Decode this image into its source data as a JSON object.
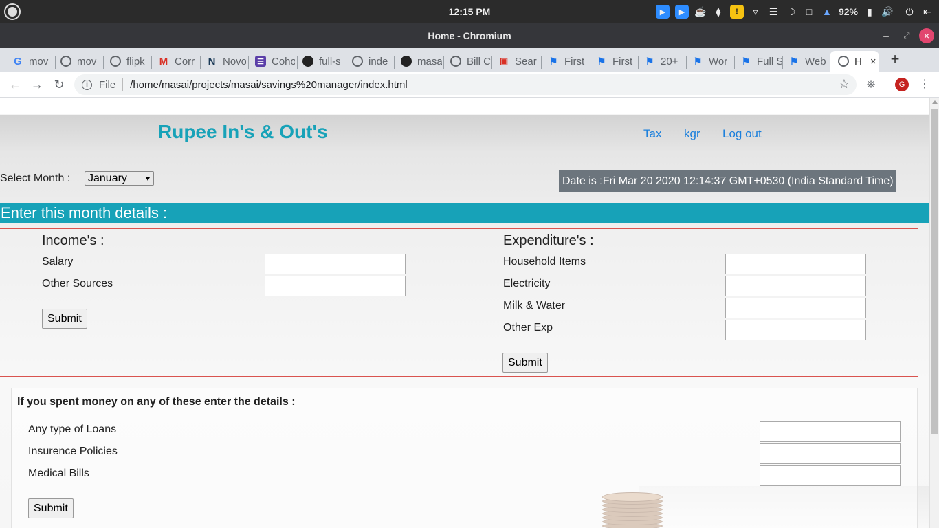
{
  "os": {
    "clock": "12:15 PM",
    "battery_percent": "92%",
    "tray_icons": [
      "zoom-icon",
      "zoom-icon",
      "coffee-icon",
      "slack-icon",
      "warning-icon",
      "wifi-icon",
      "menu-icon",
      "night-mode-icon",
      "folder-icon",
      "notification-icon",
      "battery-icon",
      "volume-icon",
      "power-icon",
      "exit-icon"
    ]
  },
  "window": {
    "title": "Home - Chromium"
  },
  "tabs": [
    {
      "label": "mov",
      "icon": "google-icon"
    },
    {
      "label": "mov",
      "icon": "globe-icon"
    },
    {
      "label": "flipk",
      "icon": "globe-icon"
    },
    {
      "label": "Corr",
      "icon": "gmail-icon"
    },
    {
      "label": "Novo",
      "icon": "n-icon"
    },
    {
      "label": "Coho",
      "icon": "list-icon"
    },
    {
      "label": "full-s",
      "icon": "github-icon"
    },
    {
      "label": "inde",
      "icon": "globe-icon"
    },
    {
      "label": "masa",
      "icon": "github-icon"
    },
    {
      "label": "Bill C",
      "icon": "globe-icon"
    },
    {
      "label": "Sear",
      "icon": "bus-icon"
    },
    {
      "label": "First",
      "icon": "bookmark-icon"
    },
    {
      "label": "First",
      "icon": "bookmark-icon"
    },
    {
      "label": "20+",
      "icon": "bookmark-icon"
    },
    {
      "label": "Wor",
      "icon": "bookmark-icon"
    },
    {
      "label": "Full S",
      "icon": "bookmark-icon"
    },
    {
      "label": "Web",
      "icon": "bookmark-icon"
    },
    {
      "label": "H",
      "icon": "globe-icon",
      "active": true
    }
  ],
  "toolbar": {
    "scheme_label": "File",
    "url": "/home/masai/projects/masai/savings%20manager/index.html",
    "profile_initial": "G"
  },
  "page": {
    "site_title": "Rupee In's & Out's",
    "nav": [
      "Tax",
      "kgr",
      "Log out"
    ],
    "month_label": "Select Month :",
    "month_selected": "January",
    "date_text": "Date is :Fri Mar 20 2020 12:14:37 GMT+0530 (India Standard Time)",
    "section_title": "Enter this month details :",
    "income": {
      "heading": "Income's :",
      "fields": [
        "Salary",
        "Other Sources"
      ],
      "submit": "Submit"
    },
    "expenditure": {
      "heading": "Expenditure's :",
      "fields": [
        "Household Items",
        "Electricity",
        "Milk & Water",
        "Other Exp"
      ],
      "submit": "Submit"
    },
    "loans": {
      "heading": "If you spent money on any of these enter the details :",
      "fields": [
        "Any type of Loans",
        "Insurence Policies",
        "Medical Bills"
      ],
      "submit": "Submit"
    }
  },
  "colors": {
    "accent": "#17a2b8",
    "link": "#1a7fdc",
    "date_bg": "#6c757d",
    "border_red": "#d9534f"
  }
}
